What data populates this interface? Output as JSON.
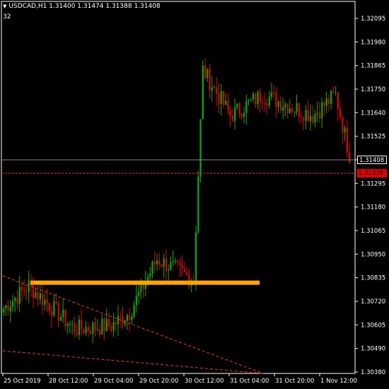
{
  "header": {
    "symbol_info": "USDCAD,H1  1.31400 1.31474 1.31388 1.31408",
    "sub_value": "32"
  },
  "price_tags": {
    "bid": "1.31408",
    "ask": "1.31338"
  },
  "colors": {
    "background": "#000000",
    "bull_candle": "#00b000",
    "bear_candle": "#e00000",
    "support_zone": "#ffa500",
    "trendline": "#ff2a2a",
    "axis": "#ffffff",
    "bid_line": "#7f8c8d"
  },
  "chart_data": {
    "type": "candlestick",
    "symbol": "USDCAD",
    "timeframe": "H1",
    "y_ticks": [
      "1.32095",
      "1.31980",
      "1.31865",
      "1.31750",
      "1.31640",
      "1.31525",
      "1.31408",
      "1.31295",
      "1.31180",
      "1.31065",
      "1.30950",
      "1.30835",
      "1.30720",
      "1.30605",
      "1.30490",
      "1.30380"
    ],
    "x_ticks": [
      "25 Oct 2019",
      "28 Oct 12:00",
      "29 Oct 04:00",
      "29 Oct 20:00",
      "30 Oct 12:00",
      "31 Oct 04:00",
      "31 Oct 20:00",
      "1 Nov 12:00"
    ],
    "ylim": [
      1.3035,
      1.3212
    ],
    "support_zone": {
      "price": 1.30785
    },
    "bid": 1.31408,
    "ask": 1.31338,
    "series_segments": [
      {
        "from": 1.3065,
        "to": 1.3077,
        "n": 12
      },
      {
        "from": 1.3077,
        "to": 1.3056,
        "n": 20
      },
      {
        "from": 1.3056,
        "to": 1.30575,
        "n": 16
      },
      {
        "from": 1.30575,
        "to": 1.3064,
        "n": 8
      },
      {
        "from": 1.3064,
        "to": 1.309,
        "n": 12
      },
      {
        "from": 1.309,
        "to": 1.308,
        "n": 16
      },
      {
        "from": 1.308,
        "to": 1.3182,
        "n": 4
      },
      {
        "from": 1.3182,
        "to": 1.316,
        "n": 12
      },
      {
        "from": 1.316,
        "to": 1.317,
        "n": 14
      },
      {
        "from": 1.317,
        "to": 1.316,
        "n": 22
      },
      {
        "from": 1.316,
        "to": 1.317,
        "n": 10
      },
      {
        "from": 1.317,
        "to": 1.31408,
        "n": 6
      }
    ]
  }
}
